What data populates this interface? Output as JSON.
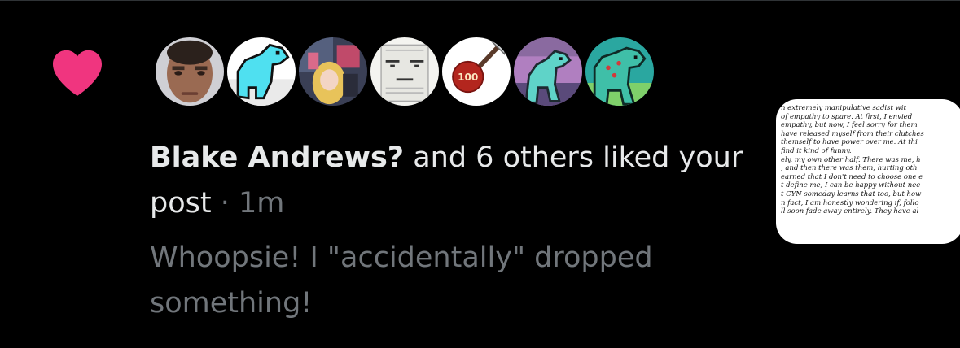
{
  "notification": {
    "type_icon": "heart-icon",
    "accent_color": "#f91880",
    "avatars": [
      {
        "name": "avatar-photo-man"
      },
      {
        "name": "avatar-pixel-dino-cyan"
      },
      {
        "name": "avatar-anime-art"
      },
      {
        "name": "avatar-paper-face"
      },
      {
        "name": "avatar-100-emoji"
      },
      {
        "name": "avatar-pixel-dino-sunset"
      },
      {
        "name": "avatar-pixel-dino-green"
      }
    ],
    "actor_name": "Blake Andrews?",
    "action_text": " and 6 others liked your post",
    "separator": " · ",
    "time": "1m",
    "post_preview": "Whoopsie! I \"accidentally\" dropped something!",
    "thumbnail_text": "n extremely manipulative sadist wit\nof empathy to spare. At first, I envied\nempathy, but now, I feel sorry for them\nhave released myself from their clutches\nthemself to have power over me. At thi\nfind it kind of funny.\nely, my own other half. There was me, h\n, and then there was them, hurting oth\nearned that I don't need to choose one e\nt define me, I can be happy without nec\nt CYN someday learns that too, but how\nn fact, I am honestly wondering if, follo\nll soon fade away entirely. They have al"
  }
}
